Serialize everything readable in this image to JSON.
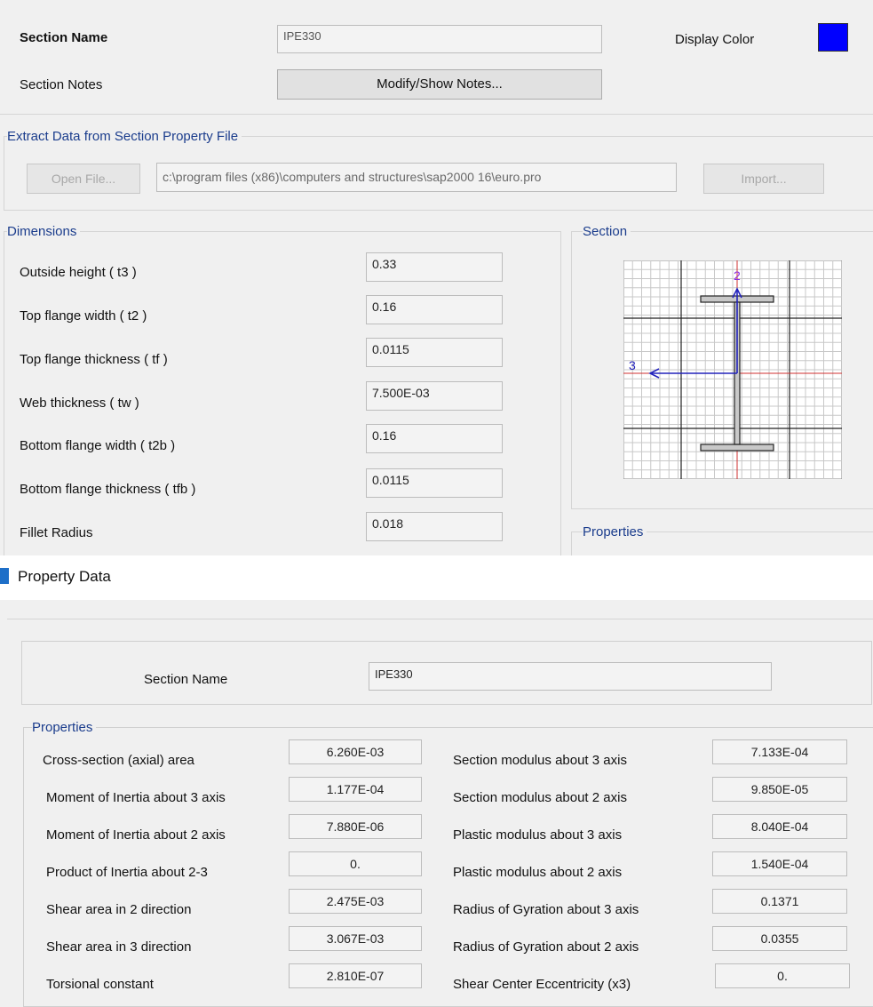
{
  "section_form": {
    "section_name_label": "Section Name",
    "section_name_value": "IPE330",
    "display_color_label": "Display Color",
    "display_color": "#0000ff",
    "section_notes_label": "Section Notes",
    "modify_notes_button": "Modify/Show Notes...",
    "extract_group_title": "Extract Data from Section Property File",
    "open_file_button": "Open File...",
    "file_path": "c:\\program files (x86)\\computers and structures\\sap2000 16\\euro.pro",
    "import_button": "Import...",
    "dimensions_title": "Dimensions",
    "dimensions": [
      {
        "label": "Outside height  ( t3 )",
        "value": "0.33"
      },
      {
        "label": "Top flange width  ( t2 )",
        "value": "0.16"
      },
      {
        "label": "Top flange thickness  ( tf )",
        "value": "0.0115"
      },
      {
        "label": "Web thickness  ( tw )",
        "value": "7.500E-03"
      },
      {
        "label": "Bottom flange width  ( t2b )",
        "value": "0.16"
      },
      {
        "label": "Bottom flange thickness  ( tfb )",
        "value": "0.0115"
      },
      {
        "label": "Fillet Radius",
        "value": "0.018"
      }
    ],
    "section_group_title": "Section",
    "axis_label_2": "2",
    "axis_label_3": "3",
    "properties_group_title": "Properties"
  },
  "property_data": {
    "window_title": "Property Data",
    "app_icon": "sap-icon",
    "section_name_label": "Section Name",
    "section_name_value": "IPE330",
    "properties_title": "Properties",
    "left_props": [
      {
        "label": "Cross-section (axial) area",
        "value": "6.260E-03"
      },
      {
        "label": "Moment of Inertia about 3 axis",
        "value": "1.177E-04"
      },
      {
        "label": "Moment of Inertia about 2 axis",
        "value": "7.880E-06"
      },
      {
        "label": "Product of Inertia about 2-3",
        "value": "0."
      },
      {
        "label": "Shear area in 2 direction",
        "value": "2.475E-03"
      },
      {
        "label": "Shear area in 3 direction",
        "value": "3.067E-03"
      },
      {
        "label": "Torsional constant",
        "value": "2.810E-07"
      }
    ],
    "right_props": [
      {
        "label": "Section modulus about 3 axis",
        "value": "7.133E-04"
      },
      {
        "label": "Section modulus about 2 axis",
        "value": "9.850E-05"
      },
      {
        "label": "Plastic modulus about 3 axis",
        "value": "8.040E-04"
      },
      {
        "label": "Plastic modulus about 2 axis",
        "value": "1.540E-04"
      },
      {
        "label": "Radius of Gyration about 3 axis",
        "value": "0.1371"
      },
      {
        "label": "Radius of Gyration about 2 axis",
        "value": "0.0355"
      },
      {
        "label": "Shear Center Eccentricity (x3)",
        "value": "0."
      }
    ]
  }
}
